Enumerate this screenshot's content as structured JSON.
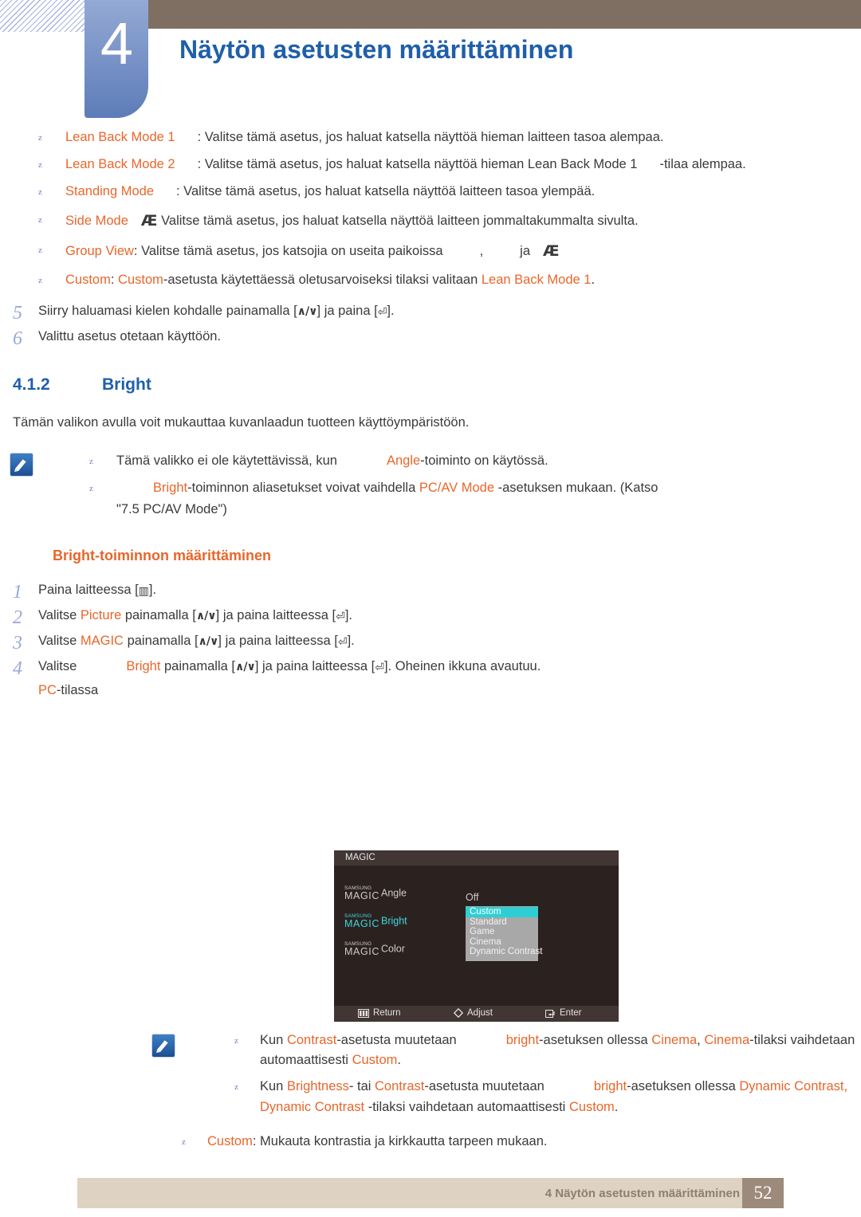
{
  "header": {
    "chapter_number": "4",
    "title": "Näytön asetusten määrittäminen"
  },
  "mode_bullets": [
    {
      "term": "Lean Back Mode 1",
      "rest": ": Valitse tämä asetus, jos haluat katsella näyttöä hieman laitteen tasoa alempaa."
    },
    {
      "term": "Lean Back Mode 2",
      "rest": ": Valitse tämä asetus, jos haluat katsella näyttöä hieman Lean Back Mode 1",
      "rest2": "-tilaa alempaa."
    },
    {
      "term": "Standing Mode",
      "rest": ": Valitse tämä asetus, jos haluat katsella näyttöä laitteen tasoa ylempää."
    },
    {
      "term": "Side Mode",
      "glyph": "Æ",
      "rest": "Valitse tämä asetus, jos haluat katsella näyttöä laitteen jommaltakummalta sivulta."
    },
    {
      "term": "Group View",
      "rest": ": Valitse tämä asetus, jos katsojia on useita paikoissa",
      "sep": ",",
      "conj": "ja",
      "glyph_end": "Æ"
    },
    {
      "term": "Custom",
      "rest": ": ",
      "term2": "Custom",
      "rest_mid": "-asetusta käytettäessä oletusarvoiseksi tilaksi valitaan ",
      "term3": "Lean Back Mode 1",
      "rest_end": "."
    }
  ],
  "steps_top": [
    {
      "num": "5",
      "pre": "Siirry haluamasi kielen kohdalle painamalla [",
      "key1": "∧/∨",
      "mid": "] ja paina [",
      "key2": "⏎",
      "post": "]."
    },
    {
      "num": "6",
      "pre": "Valittu asetus otetaan käyttöön."
    }
  ],
  "section": {
    "number": "4.1.2",
    "title": "Bright",
    "intro": "Tämän valikon avulla voit mukauttaa kuvanlaadun tuotteen käyttöympäristöön."
  },
  "note_top": {
    "icon": "note-pen-icon",
    "items": [
      {
        "pre": "Tämä valikko ei ole käytettävissä, kun",
        "term": "Angle",
        "post": "-toiminto on käytössä."
      },
      {
        "term": "Bright",
        "post1": "-toiminnon aliasetukset voivat vaihdella ",
        "term2": "PC/AV Mode",
        "post2": " -asetuksen mukaan. (Katso",
        "post3": "\"7.5 PC/AV Mode\")"
      }
    ]
  },
  "sub_heading": "Bright-toiminnon määrittäminen",
  "steps_main": [
    {
      "num": "1",
      "pre": "Paina laitteessa [",
      "key1": "▥",
      "post": "]."
    },
    {
      "num": "2",
      "pre": "Valitse ",
      "term": "Picture",
      "mid1": " painamalla [",
      "key1": "∧/∨",
      "mid2": "] ja paina laitteessa [",
      "key2": "⏎",
      "post": "]."
    },
    {
      "num": "3",
      "pre": "Valitse ",
      "term": "MAGIC",
      "mid1": " painamalla [",
      "key1": "∧/∨",
      "mid2": "] ja paina laitteessa [",
      "key2": "⏎",
      "post": "]."
    },
    {
      "num": "4",
      "pre": "Valitse",
      "term": "Bright",
      "mid1": " painamalla [",
      "key1": "∧/∨",
      "mid2": "] ja paina laitteessa [",
      "key2": "⏎",
      "post": "]. Oheinen ikkuna avautuu.",
      "sub_term": "PC",
      "sub_post": "-tilassa"
    }
  ],
  "osd": {
    "title": "MAGIC",
    "items": [
      {
        "brand_top": "SAMSUNG",
        "brand_bottom": "MAGIC",
        "label": "Angle",
        "value": "Off",
        "selected": false
      },
      {
        "brand_top": "SAMSUNG",
        "brand_bottom": "MAGIC",
        "label": "Bright",
        "value": "",
        "selected": true
      },
      {
        "brand_top": "SAMSUNG",
        "brand_bottom": "MAGIC",
        "label": "Color",
        "value": "",
        "selected": false
      }
    ],
    "options": [
      {
        "label": "Custom",
        "highlighted": true
      },
      {
        "label": "Standard",
        "highlighted": false
      },
      {
        "label": "Game",
        "highlighted": false
      },
      {
        "label": "Cinema",
        "highlighted": false
      },
      {
        "label": "Dynamic Contrast",
        "highlighted": false
      }
    ],
    "footer": [
      {
        "icon": "menu-bars-icon",
        "label": "Return"
      },
      {
        "icon": "diamond-adjust-icon",
        "label": "Adjust"
      },
      {
        "icon": "enter-key-icon",
        "label": "Enter"
      }
    ],
    "colors": {
      "background": "#2b2220",
      "titlebar": "#413634",
      "highlight": "#2ecfd4",
      "accent_text": "#3fd6da",
      "list_background": "#a8a8a8"
    }
  },
  "note_bottom": {
    "icon": "note-pen-icon",
    "items": [
      {
        "pre": "Kun ",
        "term": "Contrast",
        "mid1": "-asetusta muutetaan",
        "term2": "bright",
        "mid2": "-asetuksen ollessa ",
        "term3": "Cinema",
        "mid3": ", ",
        "term4": "Cinema",
        "mid4": "-tilaksi vaihdetaan automaattisesti ",
        "term5": "Custom",
        "end": "."
      },
      {
        "pre": "Kun ",
        "term": "Brightness",
        "mid1": "- tai ",
        "term2": "Contrast",
        "mid2": "-asetusta muutetaan",
        "term3": "bright",
        "mid3": "-asetuksen ollessa ",
        "term4": "Dynamic Contrast",
        "mid4": ", ",
        "term5": "Dynamic Contrast",
        "mid5": " -tilaksi vaihdetaan automaattisesti ",
        "term6": "Custom",
        "end": "."
      }
    ]
  },
  "final_bullet": {
    "term": "Custom",
    "rest": ": Mukauta kontrastia ja kirkkautta tarpeen mukaan."
  },
  "footer": {
    "label": "4 Näytön asetusten määrittäminen",
    "page": "52"
  },
  "colors": {
    "accent_blue": "#1f5fa9",
    "accent_orange": "#e8662a",
    "header_band": "#7f6f62",
    "footer_bar": "#ded2c2",
    "footer_page": "#9c8a7b",
    "step_number": "#9aa8d8"
  }
}
